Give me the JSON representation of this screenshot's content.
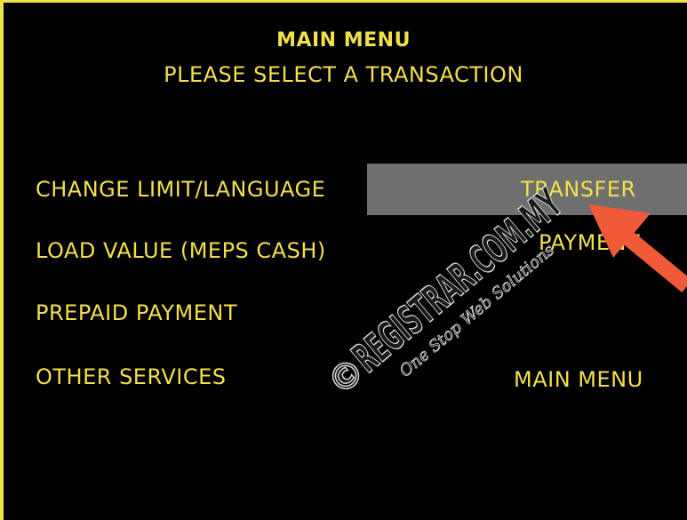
{
  "header": {
    "title": "MAIN MENU",
    "subtitle": "PLEASE SELECT A TRANSACTION"
  },
  "left_options": [
    {
      "label": "CHANGE LIMIT/LANGUAGE"
    },
    {
      "label": "LOAD VALUE (MEPS CASH)"
    },
    {
      "label": "PREPAID PAYMENT"
    },
    {
      "label": "OTHER SERVICES"
    }
  ],
  "right_options": [
    {
      "label": "TRANSFER"
    },
    {
      "label": "PAYMENT"
    },
    {
      "label": "MAIN MENU"
    }
  ],
  "watermark": {
    "copyright": "©",
    "brand": "REGISTRAR.COM.MY",
    "tagline": "One Stop Web Solutions"
  },
  "colors": {
    "background": "#000000",
    "text": "#f2e04a",
    "border": "#f2e04a",
    "highlight": "#6f6f6f",
    "arrow": "#f05a38"
  },
  "icons": {
    "pointer": "arrow-pointer-icon"
  }
}
